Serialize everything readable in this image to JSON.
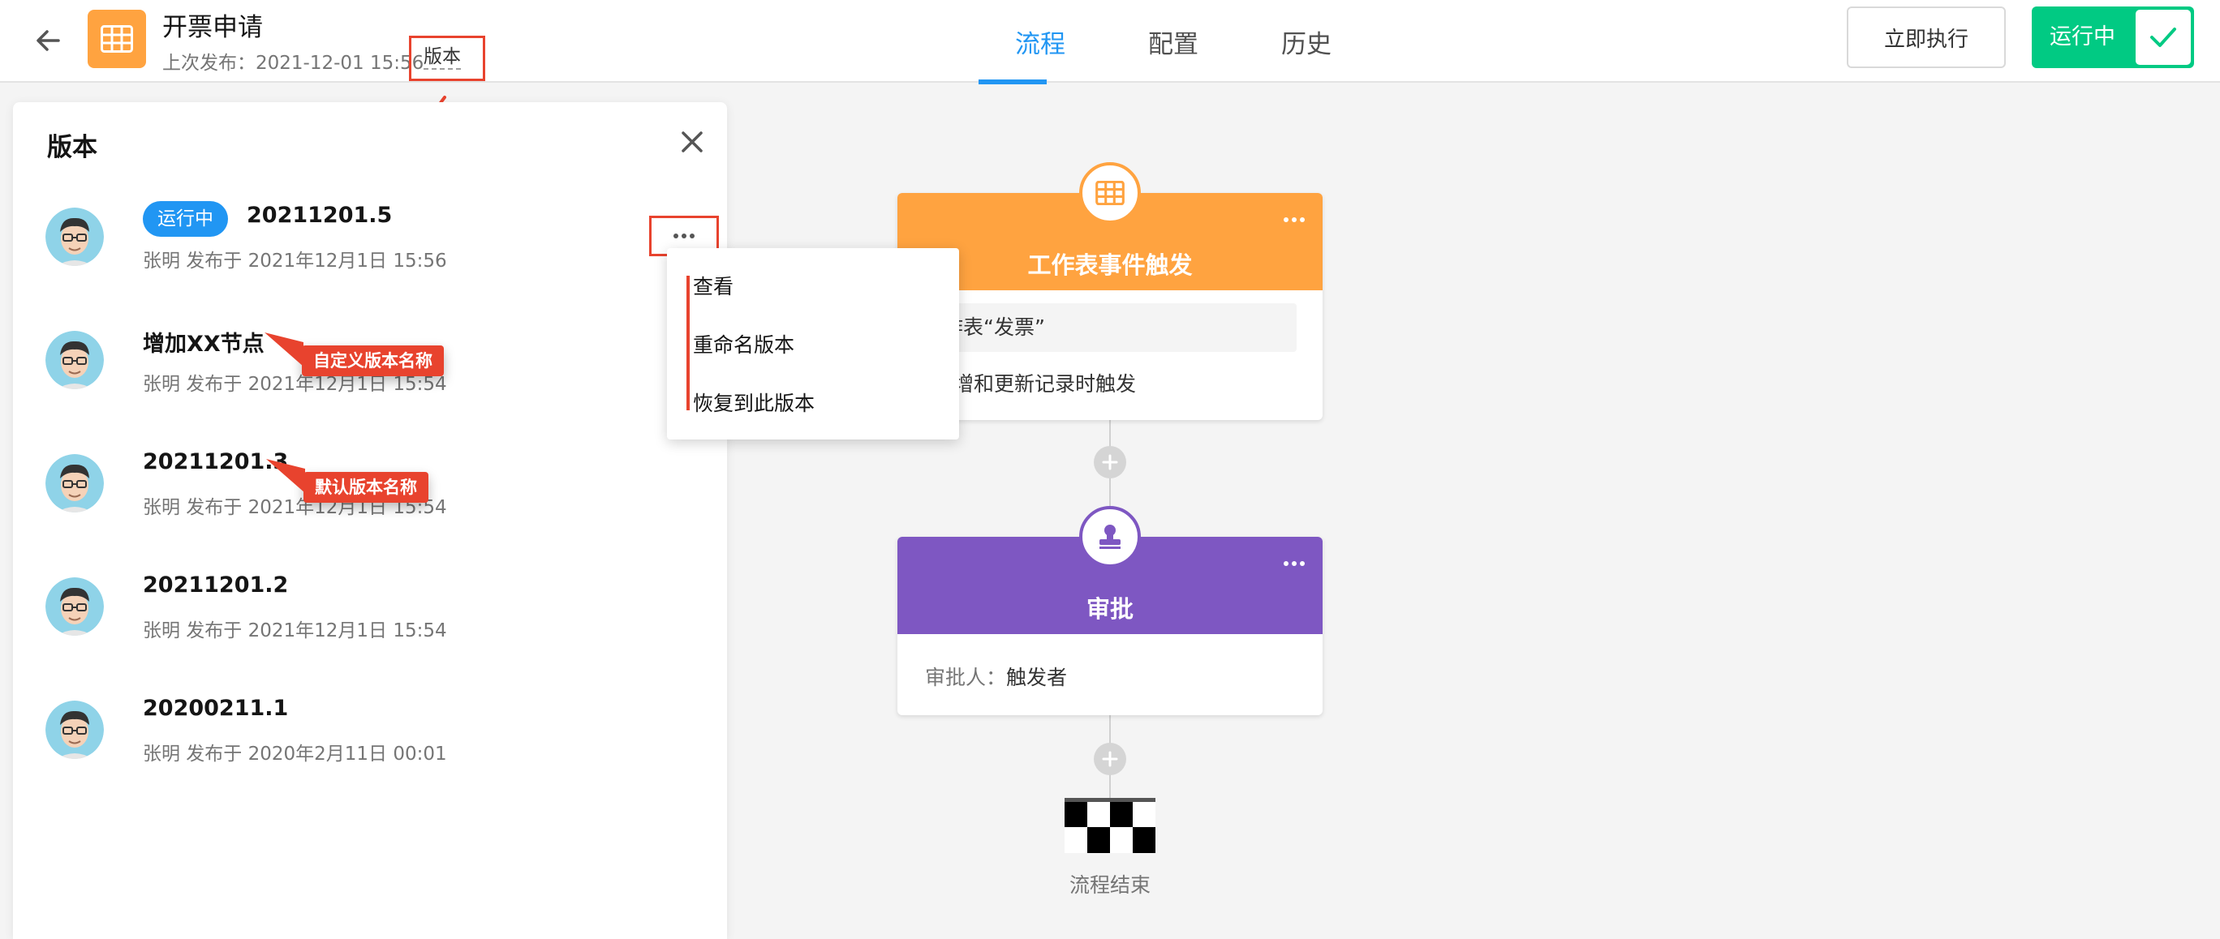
{
  "header": {
    "title": "开票申请",
    "last_published_label": "上次发布：",
    "last_published_time": "2021-12-01 15:56",
    "version_link": "版本",
    "tabs": [
      "流程",
      "配置",
      "历史"
    ],
    "active_tab": "流程",
    "run_now": "立即执行",
    "status_toggle": "运行中"
  },
  "version_panel": {
    "title": "版本",
    "running_badge": "运行中",
    "versions": [
      {
        "name": "20211201.5",
        "meta": "张明 发布于 2021年12月1日 15:56",
        "running": true
      },
      {
        "name": "增加XX节点",
        "meta": "张明 发布于 2021年12月1日 15:54"
      },
      {
        "name": "20211201.3",
        "meta": "张明 发布于 2021年12月1日 15:54"
      },
      {
        "name": "20211201.2",
        "meta": "张明 发布于 2021年12月1日 15:54"
      },
      {
        "name": "20200211.1",
        "meta": "张明 发布于 2020年2月11日 00:01"
      }
    ]
  },
  "annotations": {
    "custom_name": "自定义版本名称",
    "default_name": "默认版本名称"
  },
  "context_menu": {
    "items": [
      "查看",
      "重命名版本",
      "恢复到此版本"
    ]
  },
  "flow": {
    "trigger": {
      "title": "工作表事件触发",
      "sheet": "作表“发票”",
      "event": "新增和更新记录时触发"
    },
    "approval": {
      "title": "审批",
      "approver_label": "审批人：",
      "approver": "触发者"
    },
    "end_label": "流程结束"
  },
  "colors": {
    "accent": "#2196f3",
    "running_green": "#01ca83",
    "trigger_orange": "#ffa340",
    "approval_purple": "#7e57c2",
    "annotation_red": "#e8432e"
  }
}
